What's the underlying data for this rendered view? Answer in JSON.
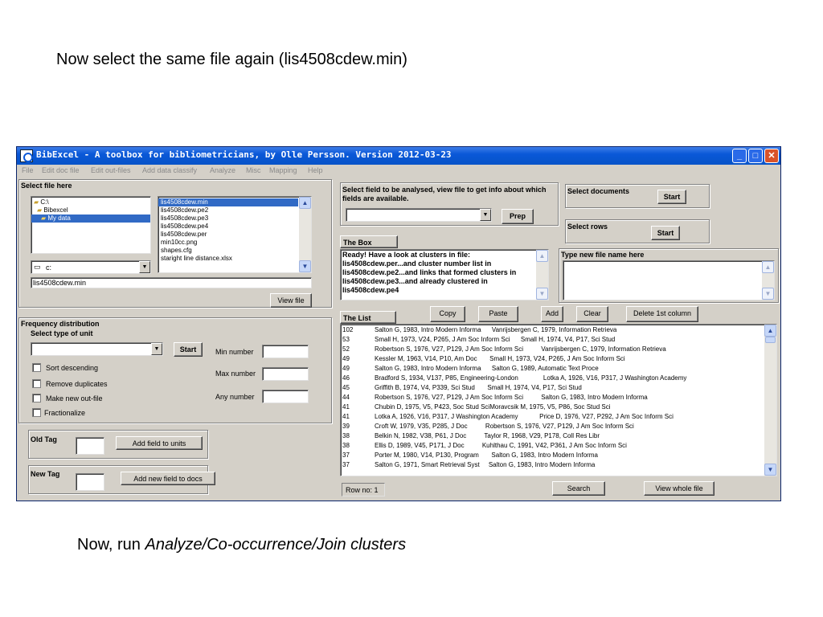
{
  "slide": {
    "top_text": "Now select the same file again (lis4508cdew.min)",
    "bottom_prefix": "Now, run ",
    "bottom_italic": "Analyze/Co-occurrence/Join clusters"
  },
  "window": {
    "title": "BibExcel - A toolbox for bibliometricians, by Olle Persson. Version 2012-03-23",
    "min_icon": "_",
    "max_icon": "□",
    "close_icon": "✕"
  },
  "menu": [
    "File",
    "Edit doc file",
    "Edit out-files",
    "Add data classify",
    "Analyze",
    "Misc",
    "Mapping",
    "Help"
  ],
  "select_file": {
    "heading": "Select file here",
    "folders": [
      "C:\\",
      "Bibexcel",
      "My data"
    ],
    "files": [
      "lis4508cdew.min",
      "lis4508cdew.pe2",
      "lis4508cdew.pe3",
      "lis4508cdew.pe4",
      "lis4508cdew.per",
      "min10cc.png",
      "shapes.cfg",
      "staright line distance.xlsx"
    ],
    "drive": "c:",
    "selected_path": "lis4508cdew.min",
    "view_file_label": "View file"
  },
  "analyse": {
    "text": "Select field to be analysed, view file to get info about which fields are available.",
    "prep_label": "Prep"
  },
  "select_docs": {
    "label": "Select documents",
    "start": "Start"
  },
  "select_rows": {
    "label": "Select rows",
    "start": "Start"
  },
  "the_box": {
    "heading": "The Box",
    "content": "Ready! Have a look at clusters in file: lis4508cdew.per...and cluster number list in lis4508cdew.pe2...and links that formed clusters in lis4508cdew.pe3...and already clustered in lis4508cdew.pe4"
  },
  "new_file": {
    "heading": "Type new file name here"
  },
  "frequency": {
    "heading": "Frequency distribution",
    "select_unit": "Select type of unit",
    "start": "Start",
    "checkboxes": [
      "Sort descending",
      "Remove duplicates",
      "Make new out-file",
      "Fractionalize"
    ],
    "min_label": "Min number",
    "max_label": "Max number",
    "any_label": "Any number"
  },
  "old_tag": {
    "label": "Old Tag",
    "button": "Add field to units"
  },
  "new_tag": {
    "label": "New Tag",
    "button": "Add new field to docs"
  },
  "the_list": {
    "heading": "The List",
    "buttons": [
      "Copy",
      "Paste",
      "Add",
      "Clear",
      "Delete 1st column"
    ],
    "rows": [
      {
        "count": "102",
        "text": "Salton G, 1983, Intro Modern Informa      Vanrijsbergen C, 1979, Information Retrieva"
      },
      {
        "count": "53",
        "text": "Small H, 1973, V24, P265, J Am Soc Inform Sci      Small H, 1974, V4, P17, Sci Stud"
      },
      {
        "count": "52",
        "text": "Robertson S, 1976, V27, P129, J Am Soc Inform Sci          Vanrijsbergen C, 1979, Information Retrieva"
      },
      {
        "count": "49",
        "text": "Kessler M, 1963, V14, P10, Am Doc       Small H, 1973, V24, P265, J Am Soc Inform Sci"
      },
      {
        "count": "49",
        "text": "Salton G, 1983, Intro Modern Informa      Salton G, 1989, Automatic Text Proce"
      },
      {
        "count": "46",
        "text": "Bradford S, 1934, V137, P85, Engineering-London              Lotka A, 1926, V16, P317, J Washington Academy"
      },
      {
        "count": "45",
        "text": "Griffith B, 1974, V4, P339, Sci Stud       Small H, 1974, V4, P17, Sci Stud"
      },
      {
        "count": "44",
        "text": "Robertson S, 1976, V27, P129, J Am Soc Inform Sci          Salton G, 1983, Intro Modern Informa"
      },
      {
        "count": "41",
        "text": "Chubin D, 1975, V5, P423, Soc Stud SciMoravcsik M, 1975, V5, P86, Soc Stud Sci"
      },
      {
        "count": "41",
        "text": "Lotka A, 1926, V16, P317, J Washington Academy            Price D, 1976, V27, P292, J Am Soc Inform Sci"
      },
      {
        "count": "39",
        "text": "Croft W, 1979, V35, P285, J Doc          Robertson S, 1976, V27, P129, J Am Soc Inform Sci"
      },
      {
        "count": "38",
        "text": "Belkin N, 1982, V38, P61, J Doc          Taylor R, 1968, V29, P178, Coll Res Libr"
      },
      {
        "count": "38",
        "text": "Ellis D, 1989, V45, P171, J Doc          Kuhlthau C, 1991, V42, P361, J Am Soc Inform Sci"
      },
      {
        "count": "37",
        "text": "Porter M, 1980, V14, P130, Program       Salton G, 1983, Intro Modern Informa"
      },
      {
        "count": "37",
        "text": "Salton G, 1971, Smart Retrieval Syst     Salton G, 1983, Intro Modern Informa"
      }
    ],
    "row_no": "Row no: 1",
    "search": "Search",
    "view_whole": "View whole file"
  }
}
